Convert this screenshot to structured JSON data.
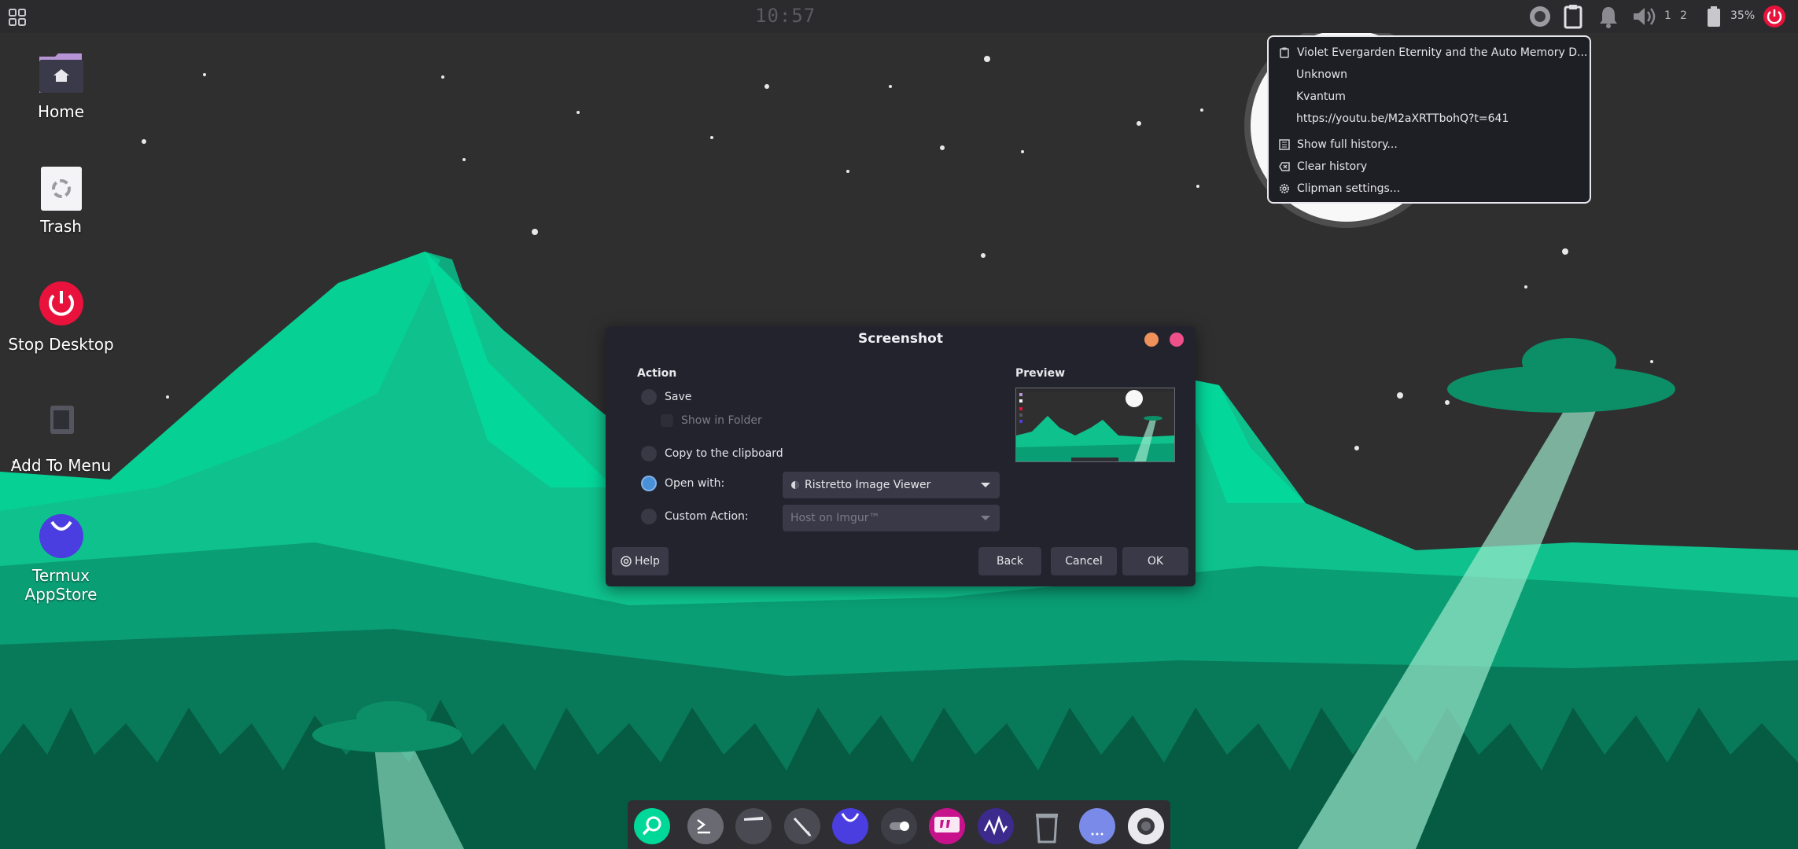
{
  "top_panel": {
    "clock": "10:57",
    "workspaces": [
      "1",
      "2"
    ],
    "battery": "35%",
    "icons": [
      "apps-menu-icon",
      "record-icon",
      "clipboard-icon",
      "bell-icon",
      "volume-icon",
      "battery-icon",
      "power-icon"
    ]
  },
  "desktop_icons": [
    {
      "label": "Home",
      "icon": "home-folder-icon"
    },
    {
      "label": "Trash",
      "icon": "trash-icon"
    },
    {
      "label": "Stop Desktop",
      "icon": "power-icon"
    },
    {
      "label": "Add To Menu",
      "icon": "add-to-menu-icon"
    },
    {
      "label": "Termux AppStore",
      "icon": "appstore-icon"
    }
  ],
  "clipman": {
    "items": [
      {
        "text": "Violet Evergarden Eternity and the Auto Memory D...",
        "icon": "clipboard-icon"
      },
      {
        "text": "Unknown"
      },
      {
        "text": "Kvantum"
      },
      {
        "text": "https://youtu.be/M2aXRTTbohQ?t=641"
      }
    ],
    "actions": [
      {
        "text": "Show full history...",
        "icon": "history-icon"
      },
      {
        "text": "Clear history",
        "icon": "clear-icon"
      },
      {
        "text": "Clipman settings...",
        "icon": "gear-icon"
      }
    ]
  },
  "dialog": {
    "title": "Screenshot",
    "action_heading": "Action",
    "preview_heading": "Preview",
    "options": {
      "save": "Save",
      "show_in_folder": "Show in Folder",
      "copy": "Copy to the clipboard",
      "open_with": "Open with:",
      "custom_action": "Custom Action:"
    },
    "selected_option": "open_with",
    "open_with_app": "Ristretto Image Viewer",
    "custom_action_value": "Host on Imgur™",
    "buttons": {
      "help": "Help",
      "back": "Back",
      "cancel": "Cancel",
      "ok": "OK"
    }
  },
  "dock": {
    "items": [
      "search-app-icon",
      "terminal-icon",
      "file-manager-icon",
      "text-editor-icon",
      "appstore-icon",
      "settings-toggle-icon",
      "quotes-app-icon",
      "audio-app-icon",
      "trash-icon",
      "drive-icon",
      "screenshot-app-icon"
    ]
  },
  "colors": {
    "accent_green": "#00d89a",
    "selected_radio": "#4a90d9",
    "close_button": "#f0508a",
    "minimize_button": "#f0905a",
    "power_red": "#e8123c"
  }
}
